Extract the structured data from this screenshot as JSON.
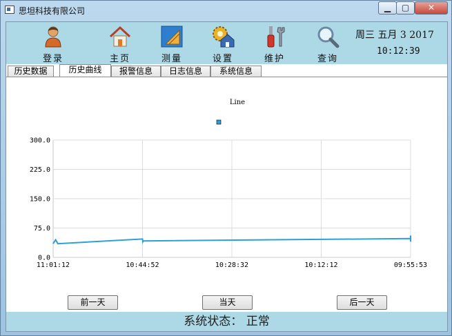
{
  "window": {
    "title": "思坦科技有限公司",
    "minimize_glyph": "▁",
    "maximize_glyph": "▢",
    "close_glyph": "✕"
  },
  "toolbar": {
    "items": [
      {
        "label": "登录",
        "icon": "user-icon"
      },
      {
        "label": "主页",
        "icon": "home-icon"
      },
      {
        "label": "测量",
        "icon": "ruler-triangle-icon"
      },
      {
        "label": "设置",
        "icon": "gear-house-icon"
      },
      {
        "label": "维护",
        "icon": "wrench-screwdriver-icon"
      },
      {
        "label": "查询",
        "icon": "magnifier-icon"
      }
    ],
    "date": "周三 五月 3 2017",
    "time": "10:12:39"
  },
  "tabs": [
    {
      "label": "历史数据",
      "active": false
    },
    {
      "label": "历史曲线",
      "active": true
    },
    {
      "label": "报警信息",
      "active": false
    },
    {
      "label": "日志信息",
      "active": false
    },
    {
      "label": "系统信息",
      "active": false
    }
  ],
  "chart_data": {
    "type": "line",
    "title": "Line",
    "legend": {
      "placement": "top-center",
      "entries": [
        ""
      ]
    },
    "x_ticks": [
      "11:01:12",
      "10:44:52",
      "10:28:32",
      "10:12:12",
      "09:55:53"
    ],
    "y_ticks": [
      "0.0",
      "75.0",
      "150.0",
      "225.0",
      "300.0"
    ],
    "ylim": [
      0,
      300
    ],
    "grid": true,
    "series": [
      {
        "color": "#2ba0d4",
        "x": [
          "11:01:12",
          "11:01:12",
          "11:01:12",
          "11:01:12",
          "10:44:52",
          "10:44:52",
          "10:44:52",
          "09:55:53",
          "09:55:53",
          "09:55:53"
        ],
        "points": [
          {
            "t": 0.0,
            "v": 35
          },
          {
            "t": 0.007,
            "v": 45
          },
          {
            "t": 0.012,
            "v": 37
          },
          {
            "t": 0.013,
            "v": 35
          },
          {
            "t": 0.25,
            "v": 47
          },
          {
            "t": 0.251,
            "v": 40
          },
          {
            "t": 0.252,
            "v": 42
          },
          {
            "t": 1.0,
            "v": 48
          },
          {
            "t": 1.0,
            "v": 40
          },
          {
            "t": 1.0,
            "v": 56
          }
        ]
      }
    ]
  },
  "navigation": {
    "prev_day": "前一天",
    "today": "当天",
    "next_day": "后一天"
  },
  "status": {
    "text": "系统状态： 正常"
  },
  "colors": {
    "toolbar_bg": "#add8e6",
    "status_bg": "#add8e6",
    "series": "#2ba0d4"
  }
}
